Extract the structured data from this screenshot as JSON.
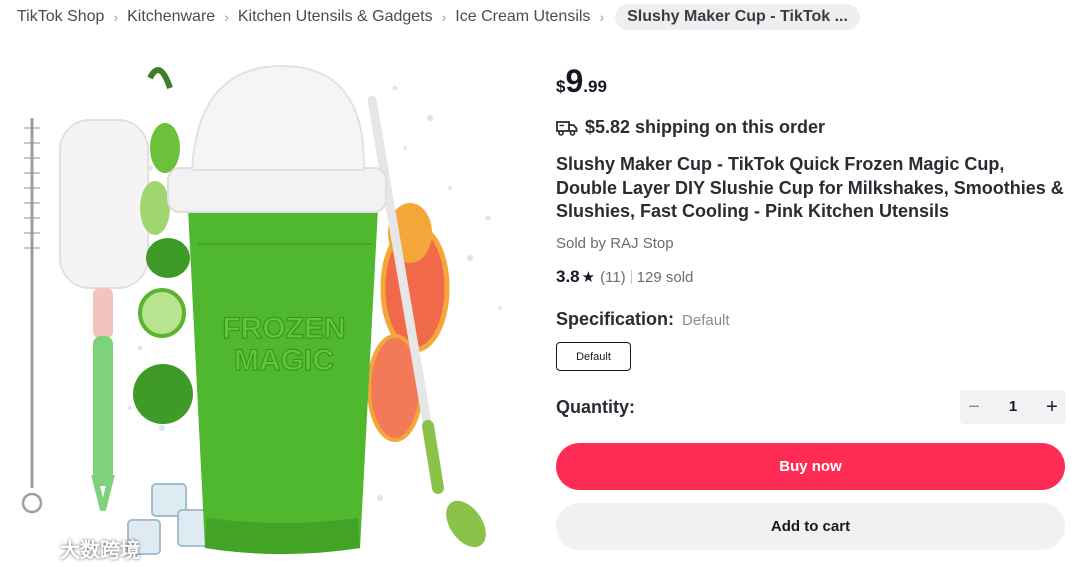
{
  "breadcrumb": {
    "items": [
      "TikTok Shop",
      "Kitchenware",
      "Kitchen Utensils & Gadgets",
      "Ice Cream Utensils"
    ],
    "current": "Slushy Maker Cup - TikTok ..."
  },
  "product_image": {
    "cup_text_line1": "FROZEN",
    "cup_text_line2": "MAGIC",
    "watermark_text": "大数跨境",
    "colors": {
      "cup_green": "#4fb82f",
      "lid": "#f2f2f2",
      "lime": "#6cc13a",
      "grapefruit": "#f06a4a",
      "brush_green": "#7ed27c"
    }
  },
  "price": {
    "currency": "$",
    "whole": "9",
    "fraction": ".99"
  },
  "shipping": {
    "text": "$5.82 shipping on this order",
    "icon": "truck-icon"
  },
  "title": "Slushy Maker Cup - TikTok Quick Frozen Magic Cup, Double Layer DIY Slushie Cup for Milkshakes, Smoothies & Slushies, Fast Cooling - Pink Kitchen Utensils",
  "seller": "Sold by RAJ Stop",
  "rating": {
    "score": "3.8",
    "count": "(11)",
    "sold": "129 sold"
  },
  "specification": {
    "label": "Specification:",
    "value": "Default",
    "options": [
      "Default"
    ]
  },
  "quantity": {
    "label": "Quantity:",
    "value": "1",
    "minus": "−",
    "plus": "+"
  },
  "actions": {
    "buy_now": "Buy now",
    "add_to_cart": "Add to cart"
  },
  "colors": {
    "accent": "#fe2c55",
    "secondary_button": "#f1f1f2",
    "text": "#161823"
  }
}
